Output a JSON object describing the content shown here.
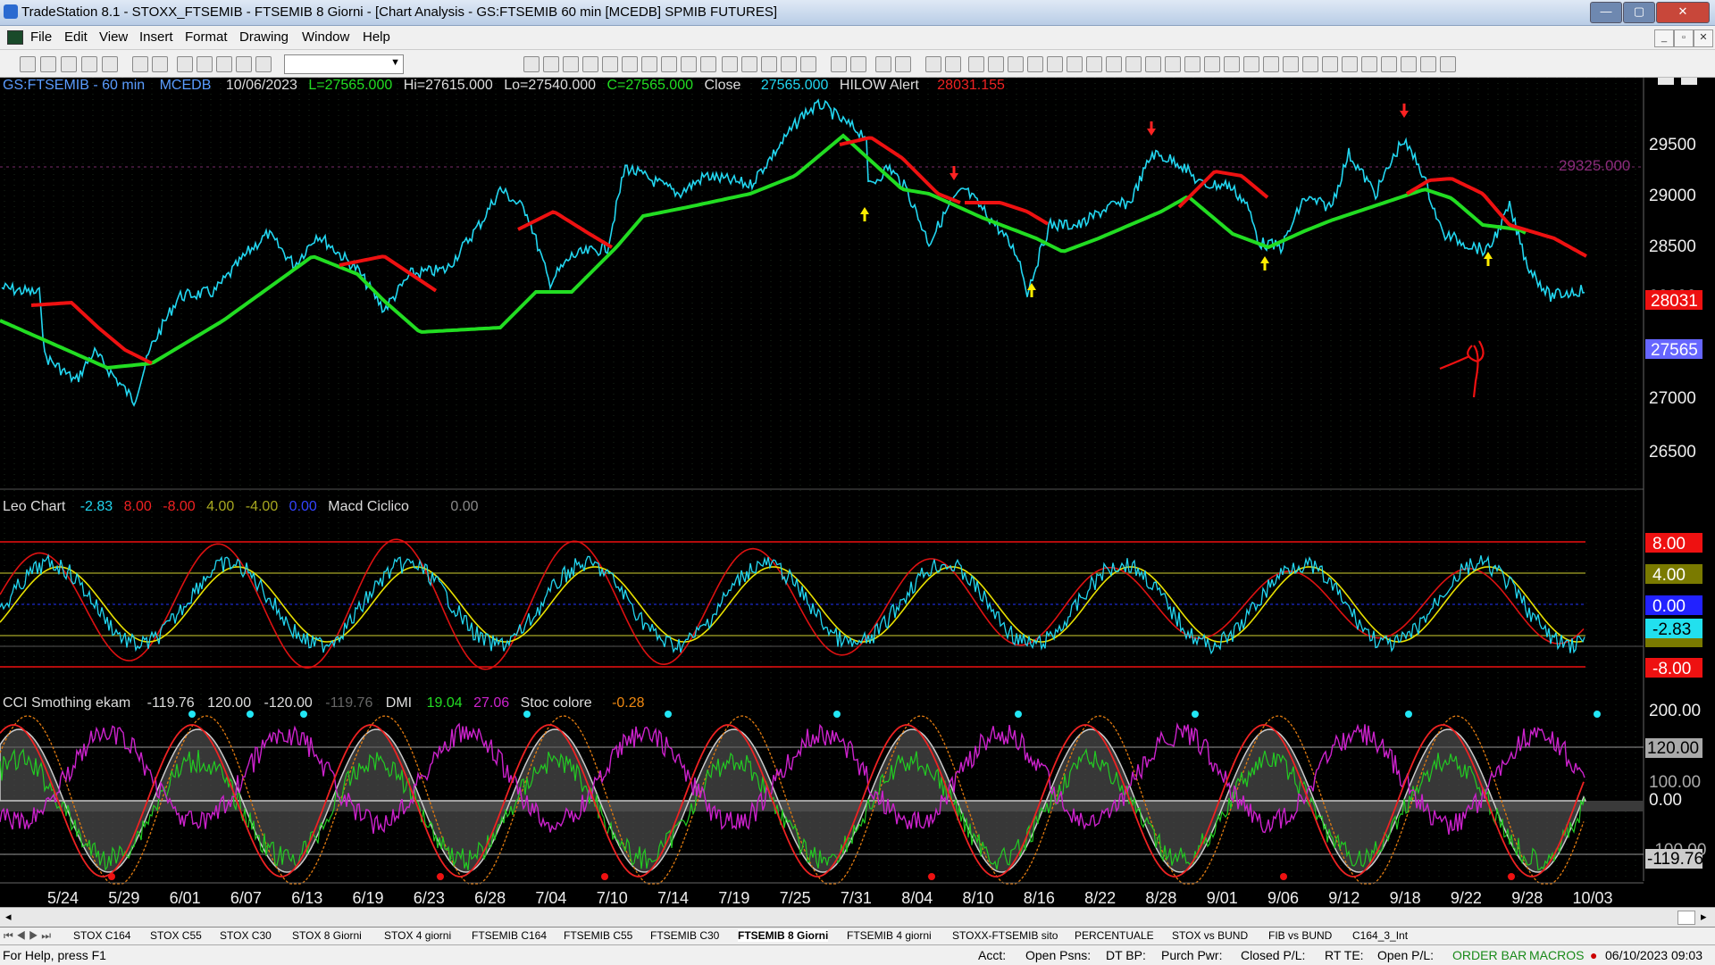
{
  "window": {
    "title": "TradeStation 8.1 - STOXX_FTSEMIB - FTSEMIB  8 Giorni - [Chart Analysis - GS:FTSEMIB  60 min  [MCEDB] SPMIB FUTURES]",
    "minimize": "—",
    "maximize": "▢",
    "close": "✕"
  },
  "menu": [
    "File",
    "Edit",
    "View",
    "Insert",
    "Format",
    "Drawing",
    "Window",
    "Help"
  ],
  "header": {
    "symbol": "GS:FTSEMIB - 60 min",
    "exchange": "MCEDB",
    "date": "10/06/2023",
    "last": "L=27565.000",
    "high": "Hi=27615.000",
    "low": "Lo=27540.000",
    "close_eq": "C=27565.000",
    "close_label": "Close",
    "close_val": "27565.000",
    "alert_label": "HILOW Alert",
    "alert_val": "28031.155"
  },
  "price_panel": {
    "axis": [
      "29500",
      "29000",
      "28500",
      "28000",
      "27500",
      "27000",
      "26500"
    ],
    "level_label": "29325.000",
    "tag_red": "28031",
    "tag_last": "27565",
    "colors": {
      "up": "#22dd22",
      "down": "#ee1111",
      "price": "#22d6f0",
      "tag_last": "#6666ff"
    }
  },
  "leo_panel": {
    "name": "Leo Chart",
    "v1": "-2.83",
    "v2": "8.00",
    "v3": "-8.00",
    "v4": "4.00",
    "v5": "-4.00",
    "v6": "0.00",
    "macd_name": "Macd Ciclico",
    "macd_val": "0.00",
    "tags": [
      "8.00",
      "4.00",
      "0.00",
      "-2.83",
      "-4.00",
      "-8.00"
    ]
  },
  "cci_panel": {
    "name": "CCI Smothing ekam",
    "v1": "-119.76",
    "v2": "120.00",
    "v3": "-120.00",
    "v4": "-119.76",
    "dmi_name": "DMI",
    "dmi1": "19.04",
    "dmi2": "27.06",
    "stoc_name": "Stoc colore",
    "stoc_val": "-0.28",
    "axis": [
      "200.00",
      "120.00",
      "100.00",
      "0.00",
      "-100.00",
      "-119.76"
    ]
  },
  "x_axis": [
    "5/24",
    "5/29",
    "6/01",
    "6/07",
    "6/13",
    "6/19",
    "6/23",
    "6/28",
    "7/04",
    "7/10",
    "7/14",
    "7/19",
    "7/25",
    "7/31",
    "8/04",
    "8/10",
    "8/16",
    "8/22",
    "8/28",
    "9/01",
    "9/06",
    "9/12",
    "9/18",
    "9/22",
    "9/28",
    "10/03"
  ],
  "tabs": [
    "STOX C164",
    "STOX C55",
    "STOX  C30",
    "STOX  8 Giorni",
    "STOX 4 giorni",
    "FTSEMIB C164",
    "FTSEMIB C55",
    "FTSEMIB C30",
    "FTSEMIB  8 Giorni",
    "FTSEMIB  4 giorni",
    "STOXX-FTSEMIB sito",
    "PERCENTUALE",
    "STOX vs BUND",
    "FIB vs BUND",
    "C164_3_Int"
  ],
  "active_tab": "FTSEMIB  8 Giorni",
  "status": {
    "help": "For Help, press F1",
    "acct": "Acct:",
    "open_psns": "Open Psns:",
    "dt_bp": "DT BP:",
    "purch_pwr": "Purch Pwr:",
    "closed_pl": "Closed P/L:",
    "rt_te": "RT TE:",
    "open_pl": "Open P/L:",
    "orderbar": "ORDER BAR",
    "macros": "MACROS",
    "datetime": "06/10/2023 09:03"
  }
}
